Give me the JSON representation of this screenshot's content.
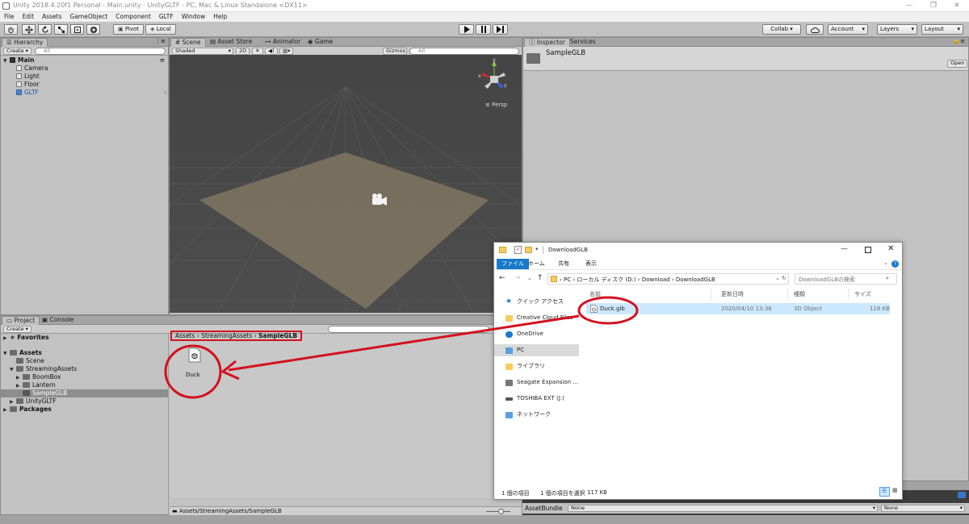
{
  "window": {
    "title": "Unity 2018.4.20f1 Personal - Main.unity - UnityGLTF - PC, Mac & Linux Standalone <DX11>",
    "controls": [
      "—",
      "❐",
      "✕"
    ]
  },
  "menu": [
    "File",
    "Edit",
    "Assets",
    "GameObject",
    "Component",
    "GLTF",
    "Window",
    "Help"
  ],
  "toolbar": {
    "pivot": "Pivot",
    "local": "Local",
    "collab": "Collab ▾",
    "account": "Account",
    "layers": "Layers",
    "layout": "Layout"
  },
  "hierarchy": {
    "tab": "Hierarchy",
    "create": "Create ▾",
    "search_placeholder": "All",
    "scene": "Main",
    "items": [
      "Camera",
      "Light",
      "Floor",
      "GLTF"
    ]
  },
  "scene": {
    "tabs": [
      "Scene",
      "Asset Store",
      "Animator",
      "Game"
    ],
    "shading": "Shaded",
    "mode2d": "2D",
    "gizmos": "Gizmos ▾",
    "search_placeholder": "All",
    "persp": "Persp",
    "gizmo_axes": [
      "y",
      "x",
      "z"
    ]
  },
  "inspector": {
    "tabs": [
      "Inspector",
      "Services"
    ],
    "object_name": "SampleGLB",
    "open_button": "Open"
  },
  "project": {
    "tabs": [
      "Project",
      "Console"
    ],
    "create": "Create ▾",
    "favorites": "Favorites",
    "assets_root": "Assets",
    "folders": [
      "Scene",
      "StreamingAssets",
      "BoomBox",
      "Lantern",
      "SampleGLB",
      "UnityGLTF"
    ],
    "packages": "Packages",
    "breadcrumb": [
      "Assets",
      "StreamingAssets",
      "SampleGLB"
    ],
    "file_label": "Duck",
    "status_path": "Assets/StreamingAssets/SampleGLB"
  },
  "assetbundle": {
    "label": "AssetBundle",
    "value1": "None",
    "value2": "None"
  },
  "explorer": {
    "title": "DownloadGLB",
    "ribbon_tabs": [
      "ファイル",
      "ホーム",
      "共有",
      "表示"
    ],
    "path": [
      "PC",
      "ローカル ディスク (D:)",
      "Download",
      "DownloadGLB"
    ],
    "search_placeholder": "DownloadGLBの検索",
    "nav": [
      "クイック アクセス",
      "Creative Cloud Files",
      "OneDrive",
      "PC",
      "ライブラリ",
      "Seagate Expansion Driv",
      "TOSHIBA EXT (J:)",
      "ネットワーク"
    ],
    "columns": [
      "名前",
      "更新日時",
      "種類",
      "サイズ"
    ],
    "file": {
      "name": "Duck.glb",
      "modified": "2020/04/10 13:36",
      "type": "3D Object",
      "size": "118 KB"
    },
    "status": {
      "count": "1 個の項目",
      "selected": "1 個の項目を選択",
      "size": "117 KB"
    }
  },
  "colors": {
    "annotation_red": "#d3101e",
    "selection_blue": "#cce8ff",
    "unity_panel": "#c2c2c2",
    "scene_bg": "#4a4a4a",
    "floor": "#7a7160"
  }
}
